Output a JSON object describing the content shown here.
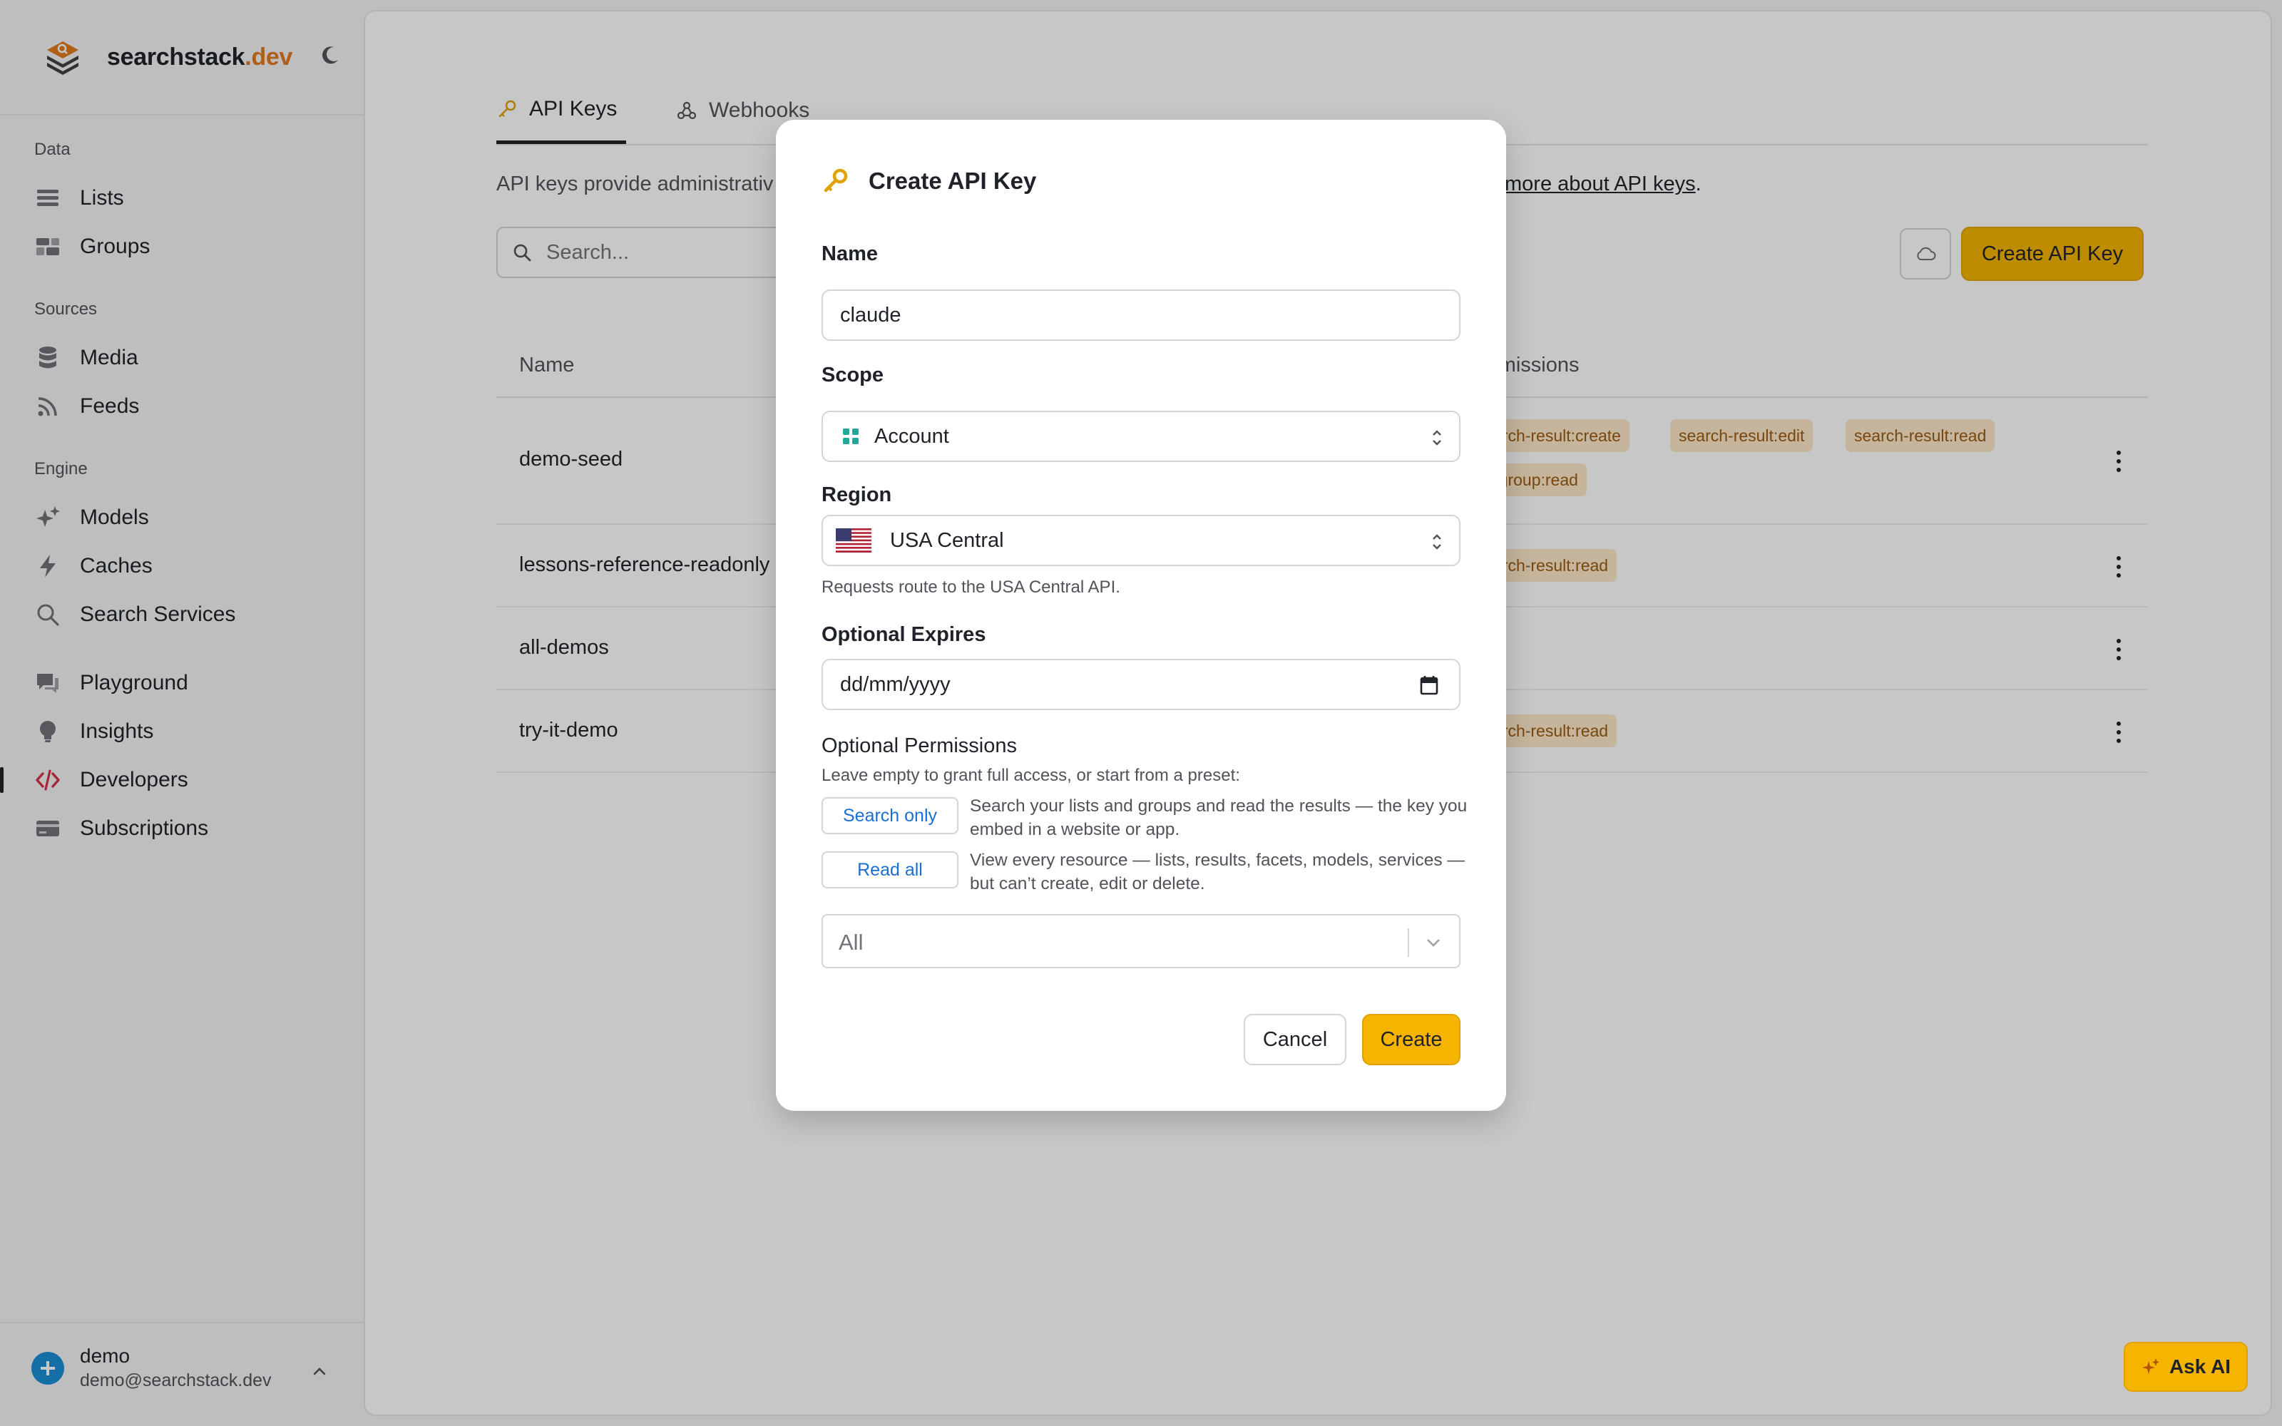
{
  "brand": {
    "name_main": "searchstack",
    "name_accent": ".dev",
    "logo_icon": "layers-search-icon",
    "theme_icon": "moon-icon"
  },
  "sidebar": {
    "sections": [
      "Data",
      "Sources",
      "Engine"
    ],
    "items": [
      {
        "label": "Lists",
        "icon": "list-icon"
      },
      {
        "label": "Groups",
        "icon": "groups-icon"
      },
      {
        "label": "Media",
        "icon": "database-icon"
      },
      {
        "label": "Feeds",
        "icon": "rss-icon"
      },
      {
        "label": "Models",
        "icon": "sparkles-icon"
      },
      {
        "label": "Caches",
        "icon": "bolt-icon"
      },
      {
        "label": "Search Services",
        "icon": "search-icon"
      },
      {
        "label": "Playground",
        "icon": "chat-icon"
      },
      {
        "label": "Insights",
        "icon": "lightbulb-icon"
      },
      {
        "label": "Developers",
        "icon": "code-icon",
        "active": true
      },
      {
        "label": "Subscriptions",
        "icon": "card-icon"
      }
    ],
    "user": {
      "name": "demo",
      "email": "demo@searchstack.dev"
    }
  },
  "main": {
    "tabs": [
      {
        "label": "API Keys",
        "icon": "key-icon",
        "active": true
      },
      {
        "label": "Webhooks",
        "icon": "webhook-icon"
      }
    ],
    "intro_text": "API keys provide administrativ",
    "intro_link": "more about API keys",
    "intro_link_suffix": ".",
    "search_placeholder": "Search...",
    "create_button": "Create API Key",
    "table": {
      "col_name": "Name",
      "col_permissions": "rmissions",
      "rows": [
        {
          "name": "demo-seed",
          "tags": [
            "arch-result:create",
            "search-result:edit",
            "search-result:read",
            "-group:read"
          ]
        },
        {
          "name": "lessons-reference-readonly",
          "tags": [
            "arch-result:read"
          ]
        },
        {
          "name": "all-demos",
          "tags": [
            ""
          ]
        },
        {
          "name": "try-it-demo",
          "tags": [
            "arch-result:read"
          ]
        }
      ]
    }
  },
  "ask_ai": {
    "label": "Ask AI"
  },
  "modal": {
    "title": "Create API Key",
    "title_icon": "key-icon",
    "name_label": "Name",
    "name_value": "claude",
    "scope_label": "Scope",
    "scope_value": "Account",
    "region_label": "Region",
    "region_value": "USA Central",
    "region_help": "Requests route to the USA Central API.",
    "expires_label": "Optional Expires",
    "expires_placeholder": "dd/mm/yyyy",
    "permissions_label": "Optional Permissions",
    "permissions_help": "Leave empty to grant full access, or start from a preset:",
    "preset_search_only": "Search only",
    "preset_search_only_desc": "Search your lists and groups and read the results — the key you embed in a website or app.",
    "preset_read_all": "Read all",
    "preset_read_all_desc": "View every resource — lists, results, facets, models, services — but can’t create, edit or delete.",
    "permissions_select": "All",
    "cancel": "Cancel",
    "create": "Create"
  },
  "colors": {
    "accent": "#f4b400",
    "brand_orange": "#e07a1f",
    "developers_active": "#d6304a",
    "scope_icon": "#1fa99a"
  }
}
